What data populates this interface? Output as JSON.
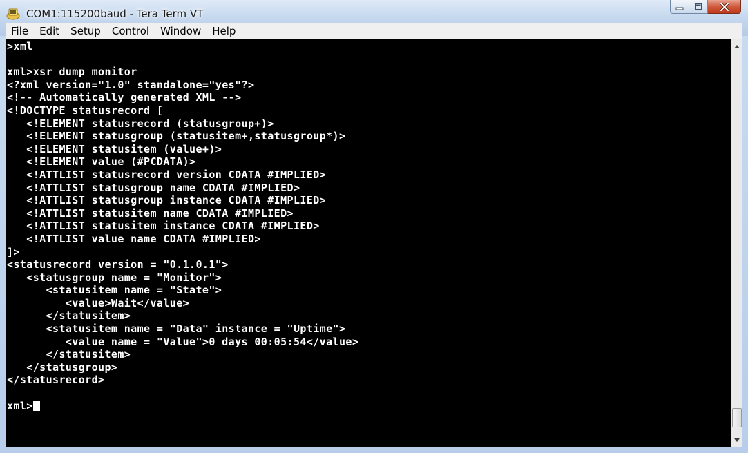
{
  "window": {
    "title": "COM1:115200baud - Tera Term VT",
    "icon": "tera-term-icon",
    "controls": [
      "minimize-icon",
      "maximize-icon",
      "close-icon"
    ]
  },
  "menu": [
    {
      "label": "File"
    },
    {
      "label": "Edit"
    },
    {
      "label": "Setup"
    },
    {
      "label": "Control"
    },
    {
      "label": "Window"
    },
    {
      "label": "Help"
    }
  ],
  "terminal": {
    "lines": [
      ">xml",
      "",
      "xml>xsr dump monitor",
      "<?xml version=\"1.0\" standalone=\"yes\"?>",
      "<!-- Automatically generated XML -->",
      "<!DOCTYPE statusrecord [",
      "   <!ELEMENT statusrecord (statusgroup+)>",
      "   <!ELEMENT statusgroup (statusitem+,statusgroup*)>",
      "   <!ELEMENT statusitem (value+)>",
      "   <!ELEMENT value (#PCDATA)>",
      "   <!ATTLIST statusrecord version CDATA #IMPLIED>",
      "   <!ATTLIST statusgroup name CDATA #IMPLIED>",
      "   <!ATTLIST statusgroup instance CDATA #IMPLIED>",
      "   <!ATTLIST statusitem name CDATA #IMPLIED>",
      "   <!ATTLIST statusitem instance CDATA #IMPLIED>",
      "   <!ATTLIST value name CDATA #IMPLIED>",
      "]>",
      "<statusrecord version = \"0.1.0.1\">",
      "   <statusgroup name = \"Monitor\">",
      "      <statusitem name = \"State\">",
      "         <value>Wait</value>",
      "      </statusitem>",
      "      <statusitem name = \"Data\" instance = \"Uptime\">",
      "         <value name = \"Value\">0 days 00:05:54</value>",
      "      </statusitem>",
      "   </statusgroup>",
      "</statusrecord>",
      "",
      "xml>"
    ]
  },
  "colors": {
    "terminal_bg": "#000000",
    "terminal_fg": "#ffffff",
    "close_button": "#c8472a"
  }
}
